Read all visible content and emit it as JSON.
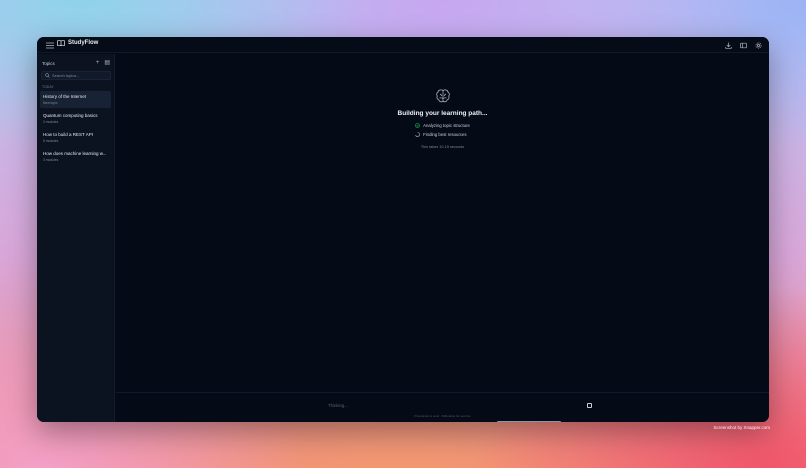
{
  "app": {
    "name": "StudyFlow"
  },
  "colors": {
    "accent_success": "#22c55e",
    "background": "#050b16",
    "sidebar": "#0b1321"
  },
  "titlebar": {
    "icons": [
      "menu-icon",
      "book-icon",
      "download-icon",
      "panel-icon",
      "gear-icon"
    ]
  },
  "sidebar": {
    "title": "Topics",
    "add_icon": "+",
    "panel_icon": "▤",
    "search_placeholder": "Search topics...",
    "group_label": "TODAY",
    "items": [
      {
        "title": "History of the Internet",
        "subtitle": "New topic",
        "active": true
      },
      {
        "title": "Quantum computing basics",
        "subtitle": "3 modules",
        "active": false
      },
      {
        "title": "How to build a REST API",
        "subtitle": "5 modules",
        "active": false
      },
      {
        "title": "How does machine learning w...",
        "subtitle": "3 modules",
        "active": false
      }
    ]
  },
  "main": {
    "loader": {
      "icon": "brain-icon",
      "title": "Building your learning path...",
      "steps": [
        {
          "label": "Analyzing topic structure",
          "status": "done"
        },
        {
          "label": "Finding best resources",
          "status": "in-progress"
        }
      ],
      "note": "This takes 10-15 seconds"
    },
    "input": {
      "placeholder": "Thinking...",
      "hint": "Press Enter to send · Shift+Enter for new line"
    }
  },
  "watermark": "Screenshot by Xnapper.com"
}
